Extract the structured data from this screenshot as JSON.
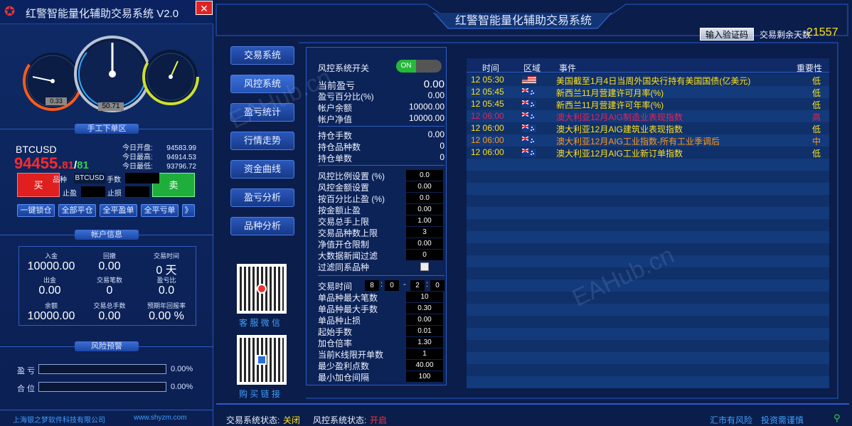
{
  "app": {
    "title": "红警智能量化辅助交易系统",
    "version": "V2.0"
  },
  "gauges": {
    "left_value": "0.33",
    "center_value": "50.71"
  },
  "manual": {
    "section": "手工下单区",
    "symbol": "BTCUSD",
    "price_main": "94455.",
    "price_frac": "81",
    "price_sep": "/",
    "price_frac2": "81",
    "stats": [
      {
        "k": "今日开盘:",
        "v": "94583.99"
      },
      {
        "k": "今日最高:",
        "v": "94914.53"
      },
      {
        "k": "今日最低:",
        "v": "93796.72"
      }
    ],
    "buy": "买",
    "sell": "卖",
    "symbol_label": "品种",
    "symbol_value": "BTCUSD",
    "lots_label": "手数",
    "tp_label": "止盈",
    "sl_label": "止损",
    "actions": [
      "一键锁仓",
      "全部平仓",
      "全平盈单",
      "全平亏单",
      "》"
    ]
  },
  "account": {
    "section": "帐户信息",
    "items": [
      {
        "k": "入金",
        "v": "10000.00"
      },
      {
        "k": "回撤",
        "v": "0.00"
      },
      {
        "k": "交易时间",
        "v": "0 天"
      },
      {
        "k": "出金",
        "v": "0.00"
      },
      {
        "k": "交易笔数",
        "v": "0"
      },
      {
        "k": "盈亏比",
        "v": "0.0"
      },
      {
        "k": "余额",
        "v": "10000.00"
      },
      {
        "k": "交易总手数",
        "v": "0.00"
      },
      {
        "k": "预期年回报率",
        "v": "0.00 %"
      }
    ]
  },
  "risk": {
    "section": "风险预警",
    "rows": [
      {
        "k": "盈 亏",
        "v": "0.00%"
      },
      {
        "k": "合 位",
        "v": "0.00%"
      }
    ]
  },
  "footer_left": {
    "company": "上海银之梦软件科技有限公司",
    "site": "www.shyzm.com"
  },
  "main": {
    "title": "红警智能量化辅助交易系统",
    "verify_button": "输入验证码",
    "days_label": "交易剩余天数",
    "days_value": "21557",
    "nav": [
      "交易系统",
      "风控系统",
      "盈亏统计",
      "行情走势",
      "资金曲线",
      "盈亏分析",
      "品种分析"
    ],
    "qr1_caption": "客 服 微 信",
    "qr2_caption": "购 买 链 接"
  },
  "params": {
    "switch_label": "风控系统开关",
    "switch_state": "ON",
    "g1": [
      {
        "k": "当前盈亏",
        "v": "0.00"
      },
      {
        "k": "盈亏百分比(%)",
        "v": "0.00"
      },
      {
        "k": "帐户余额",
        "v": "10000.00"
      },
      {
        "k": "帐户净值",
        "v": "10000.00"
      }
    ],
    "g2": [
      {
        "k": "持仓手数",
        "v": "0.00"
      },
      {
        "k": "持仓品种数",
        "v": "0"
      },
      {
        "k": "持仓单数",
        "v": "0"
      }
    ],
    "g3": [
      {
        "k": "风控比例设置 (%)",
        "v": "0.0"
      },
      {
        "k": "风控金额设置",
        "v": "0.00"
      },
      {
        "k": "按百分比止盈 (%)",
        "v": "0.0"
      },
      {
        "k": "按金额止盈",
        "v": "0.00"
      },
      {
        "k": "交易总手上限",
        "v": "1.00"
      },
      {
        "k": "交易品种数上限",
        "v": "3"
      },
      {
        "k": "净值开仓限制",
        "v": "0.00"
      },
      {
        "k": "大数据新闻过滤",
        "v": "0"
      }
    ],
    "filter_label": "过滤同系品种",
    "time_label": "交易时间",
    "time_values": [
      "8",
      "0",
      "2",
      "0"
    ],
    "time_sep": ":",
    "time_dash": "-",
    "g4": [
      {
        "k": "单品种最大笔数",
        "v": "10"
      },
      {
        "k": "单品种最大手数",
        "v": "0.30"
      },
      {
        "k": "单品种止损",
        "v": "0.00"
      },
      {
        "k": "起始手数",
        "v": "0.01"
      },
      {
        "k": "加仓倍率",
        "v": "1.30"
      },
      {
        "k": "当前K线限开单数",
        "v": "1"
      },
      {
        "k": "最少盈利点数",
        "v": "40.00"
      },
      {
        "k": "最小加仓间隔",
        "v": "100"
      }
    ]
  },
  "news": {
    "headers": [
      "时间",
      "区域",
      "事件",
      "重要性"
    ],
    "rows": [
      {
        "time": "12 05:30",
        "flag": "us",
        "event": "美国截至1月4日当周外国央行持有美国国债(亿美元)",
        "imp": "低",
        "color": "#ffe21a"
      },
      {
        "time": "12 05:45",
        "flag": "nz",
        "event": "新西兰11月营建许可月率(%)",
        "imp": "低",
        "color": "#ffe21a"
      },
      {
        "time": "12 05:45",
        "flag": "nz",
        "event": "新西兰11月营建许可年率(%)",
        "imp": "低",
        "color": "#ffe21a"
      },
      {
        "time": "12 06:00",
        "flag": "au",
        "event": "澳大利亚12月AIG制造业表现指数",
        "imp": "高",
        "color": "#e0245e"
      },
      {
        "time": "12 06:00",
        "flag": "au",
        "event": "澳大利亚12月AIG建筑业表现指数",
        "imp": "低",
        "color": "#ffe21a"
      },
      {
        "time": "12 06:00",
        "flag": "au",
        "event": "澳大利亚12月AIG工业指数-所有工业季调后",
        "imp": "中",
        "color": "#ff9a1a"
      },
      {
        "time": "12 06:00",
        "flag": "au",
        "event": "澳大利亚12月AIG工业新订单指数",
        "imp": "低",
        "color": "#ffe21a"
      }
    ]
  },
  "status": {
    "trade_label": "交易系统状态:",
    "trade_value": "关闭",
    "risk_label": "风控系统状态:",
    "risk_value": "开启",
    "right1": "汇市有风险",
    "right2": "投资需谨慎"
  },
  "watermark": "EAHub.cn",
  "colors": {
    "buy": "#e01f1f",
    "sell": "#1fae3c",
    "price": "#ff2a2a",
    "frac2": "#2fd14a",
    "on": "#25b83a",
    "risk_on": "#ff3030"
  }
}
